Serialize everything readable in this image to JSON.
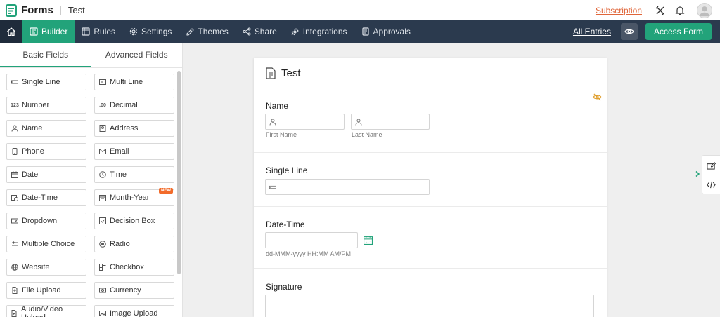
{
  "topbar": {
    "app_name": "Forms",
    "form_name": "Test",
    "subscription_link": "Subscription"
  },
  "nav": {
    "items": [
      {
        "label": "Builder",
        "icon": "builder-icon",
        "active": true
      },
      {
        "label": "Rules",
        "icon": "rules-icon"
      },
      {
        "label": "Settings",
        "icon": "gear-icon"
      },
      {
        "label": "Themes",
        "icon": "paint-icon"
      },
      {
        "label": "Share",
        "icon": "share-icon"
      },
      {
        "label": "Integrations",
        "icon": "plug-icon"
      },
      {
        "label": "Approvals",
        "icon": "approvals-icon"
      }
    ],
    "all_entries": "All Entries",
    "access_form": "Access Form"
  },
  "panel": {
    "tabs": [
      {
        "label": "Basic Fields",
        "active": true
      },
      {
        "label": "Advanced Fields"
      }
    ],
    "fields": [
      {
        "label": "Single Line",
        "icon": "single-line-icon"
      },
      {
        "label": "Multi Line",
        "icon": "multi-line-icon"
      },
      {
        "label": "Number",
        "icon": "number-icon"
      },
      {
        "label": "Decimal",
        "icon": "decimal-icon"
      },
      {
        "label": "Name",
        "icon": "person-icon"
      },
      {
        "label": "Address",
        "icon": "address-icon"
      },
      {
        "label": "Phone",
        "icon": "phone-icon"
      },
      {
        "label": "Email",
        "icon": "mail-icon"
      },
      {
        "label": "Date",
        "icon": "calendar-icon"
      },
      {
        "label": "Time",
        "icon": "clock-icon"
      },
      {
        "label": "Date-Time",
        "icon": "date-time-icon"
      },
      {
        "label": "Month-Year",
        "icon": "month-year-icon",
        "badge": "NEW"
      },
      {
        "label": "Dropdown",
        "icon": "dropdown-icon"
      },
      {
        "label": "Decision Box",
        "icon": "checkbox-checked-icon"
      },
      {
        "label": "Multiple Choice",
        "icon": "multiple-choice-icon"
      },
      {
        "label": "Radio",
        "icon": "radio-icon"
      },
      {
        "label": "Website",
        "icon": "globe-icon"
      },
      {
        "label": "Checkbox",
        "icon": "checkbox-list-icon"
      },
      {
        "label": "File Upload",
        "icon": "file-upload-icon"
      },
      {
        "label": "Currency",
        "icon": "currency-icon"
      },
      {
        "label": "Audio/Video Upload",
        "icon": "media-upload-icon"
      },
      {
        "label": "Image Upload",
        "icon": "image-upload-icon"
      }
    ]
  },
  "form": {
    "title": "Test",
    "name_field": {
      "label": "Name",
      "first_sub": "First Name",
      "last_sub": "Last Name"
    },
    "single_line": {
      "label": "Single Line"
    },
    "date_time": {
      "label": "Date-Time",
      "format_hint": "dd-MMM-yyyy HH:MM AM/PM"
    },
    "signature": {
      "label": "Signature"
    }
  },
  "colors": {
    "accent": "#22a37a",
    "nav_bg": "#2b3a4e",
    "subscription": "#e0663a",
    "hidden_icon": "#e0a030"
  }
}
